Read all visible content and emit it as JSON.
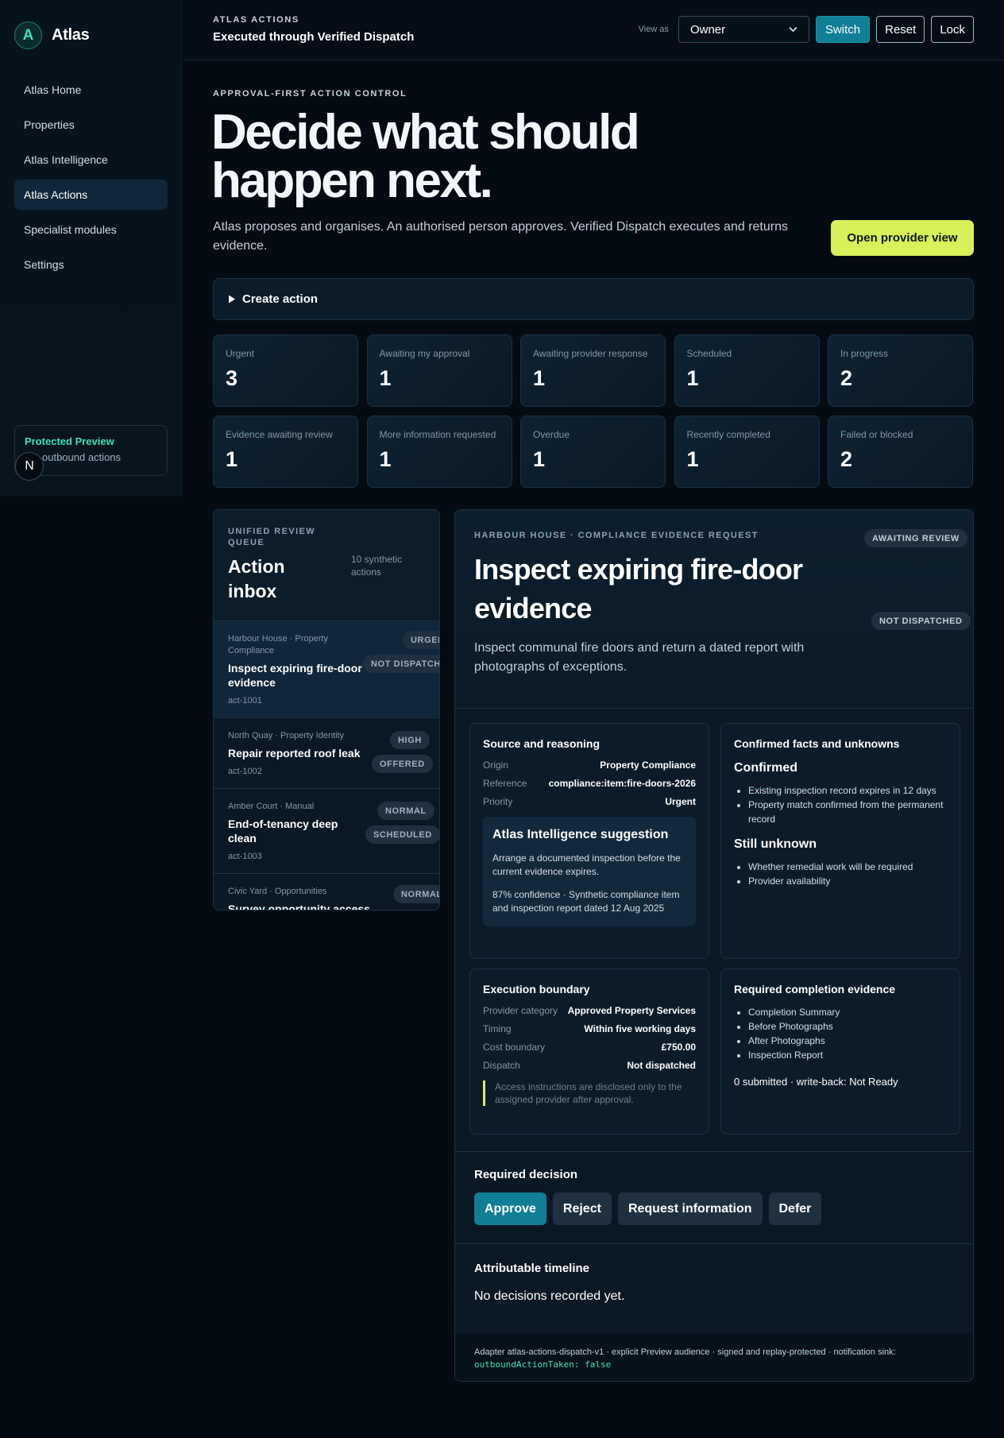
{
  "brand": {
    "logo_letter": "A",
    "name": "Atlas"
  },
  "sidebar": {
    "items": [
      {
        "label": "Atlas Home"
      },
      {
        "label": "Properties"
      },
      {
        "label": "Atlas Intelligence"
      },
      {
        "label": "Atlas Actions",
        "active": true
      },
      {
        "label": "Specialist modules"
      },
      {
        "label": "Settings"
      }
    ],
    "preview": {
      "title": "Protected Preview",
      "subtitle": "outbound actions"
    },
    "avatar_letter": "N"
  },
  "header": {
    "eyebrow": "ATLAS ACTIONS",
    "title": "Executed through Verified Dispatch",
    "view_as_label": "View as",
    "view_as_value": "Owner",
    "switch_label": "Switch",
    "reset_label": "Reset",
    "lock_label": "Lock"
  },
  "hero": {
    "eyebrow": "APPROVAL-FIRST ACTION CONTROL",
    "title": "Decide what should happen next.",
    "description": "Atlas proposes and organises. An authorised person approves. Verified Dispatch executes and returns evidence.",
    "provider_button": "Open provider view",
    "create_action": "Create action"
  },
  "stats": [
    {
      "label": "Urgent",
      "value": "3"
    },
    {
      "label": "Awaiting my approval",
      "value": "1"
    },
    {
      "label": "Awaiting provider response",
      "value": "1"
    },
    {
      "label": "Scheduled",
      "value": "1"
    },
    {
      "label": "In progress",
      "value": "2"
    },
    {
      "label": "Evidence awaiting review",
      "value": "1"
    },
    {
      "label": "More information requested",
      "value": "1"
    },
    {
      "label": "Overdue",
      "value": "1"
    },
    {
      "label": "Recently completed",
      "value": "1"
    },
    {
      "label": "Failed or blocked",
      "value": "2"
    }
  ],
  "inbox": {
    "eyebrow": "UNIFIED REVIEW QUEUE",
    "title": "Action inbox",
    "count": "10 synthetic actions",
    "items": [
      {
        "meta": "Harbour House · Property Compliance",
        "title": "Inspect expiring fire-door evidence",
        "id": "act-1001",
        "badge1": "URGENT",
        "badge2": "NOT DISPATCHED"
      },
      {
        "meta": "North Quay · Property Identity",
        "title": "Repair reported roof leak",
        "id": "act-1002",
        "badge1": "HIGH",
        "badge2": "OFFERED"
      },
      {
        "meta": "Amber Court · Manual",
        "title": "End-of-tenancy deep clean",
        "id": "act-1003",
        "badge1": "NORMAL",
        "badge2": "SCHEDULED"
      },
      {
        "meta": "Civic Yard · Opportunities",
        "title": "Survey opportunity access",
        "id": "",
        "badge1": "NORMAL",
        "badge2": ""
      }
    ]
  },
  "detail": {
    "eyebrow": "HARBOUR HOUSE · COMPLIANCE EVIDENCE REQUEST",
    "status_badge": "AWAITING REVIEW",
    "dispatch_badge": "NOT DISPATCHED",
    "title": "Inspect expiring fire-door evidence",
    "description": "Inspect communal fire doors and return a dated report with photographs of exceptions.",
    "source": {
      "heading": "Source and reasoning",
      "rows": [
        {
          "k": "Origin",
          "v": "Property Compliance"
        },
        {
          "k": "Reference",
          "v": "compliance:item:fire-doors-2026"
        },
        {
          "k": "Priority",
          "v": "Urgent"
        }
      ],
      "suggestion_title": "Atlas Intelligence suggestion",
      "suggestion_text": "Arrange a documented inspection before the current evidence expires.",
      "suggestion_confidence": "87% confidence · Synthetic compliance item and inspection report dated 12 Aug 2025"
    },
    "facts": {
      "heading": "Confirmed facts and unknowns",
      "confirmed_label": "Confirmed",
      "confirmed": [
        "Existing inspection record expires in 12 days",
        "Property match confirmed from the permanent record"
      ],
      "unknown_label": "Still unknown",
      "unknown": [
        "Whether remedial work will be required",
        "Provider availability"
      ]
    },
    "boundary": {
      "heading": "Execution boundary",
      "rows": [
        {
          "k": "Provider category",
          "v": "Approved Property Services"
        },
        {
          "k": "Timing",
          "v": "Within five working days"
        },
        {
          "k": "Cost boundary",
          "v": "£750.00"
        },
        {
          "k": "Dispatch",
          "v": "Not dispatched"
        }
      ],
      "note": "Access instructions are disclosed only to the assigned provider after approval."
    },
    "evidence": {
      "heading": "Required completion evidence",
      "items": [
        "Completion Summary",
        "Before Photographs",
        "After Photographs",
        "Inspection Report"
      ],
      "status": "0 submitted · write-back: Not Ready"
    },
    "decision": {
      "heading": "Required decision",
      "approve": "Approve",
      "reject": "Reject",
      "request_info": "Request information",
      "defer": "Defer"
    },
    "timeline": {
      "heading": "Attributable timeline",
      "empty": "No decisions recorded yet."
    },
    "footer": {
      "text": "Adapter atlas-actions-dispatch-v1 · explicit Preview audience · signed and replay-protected · notification sink:",
      "code": "outboundActionTaken: false"
    }
  },
  "colors": {
    "accent_teal": "#107e95",
    "accent_lime": "#d8f059",
    "accent_green": "#3ee0b4",
    "background": "#050b13"
  }
}
